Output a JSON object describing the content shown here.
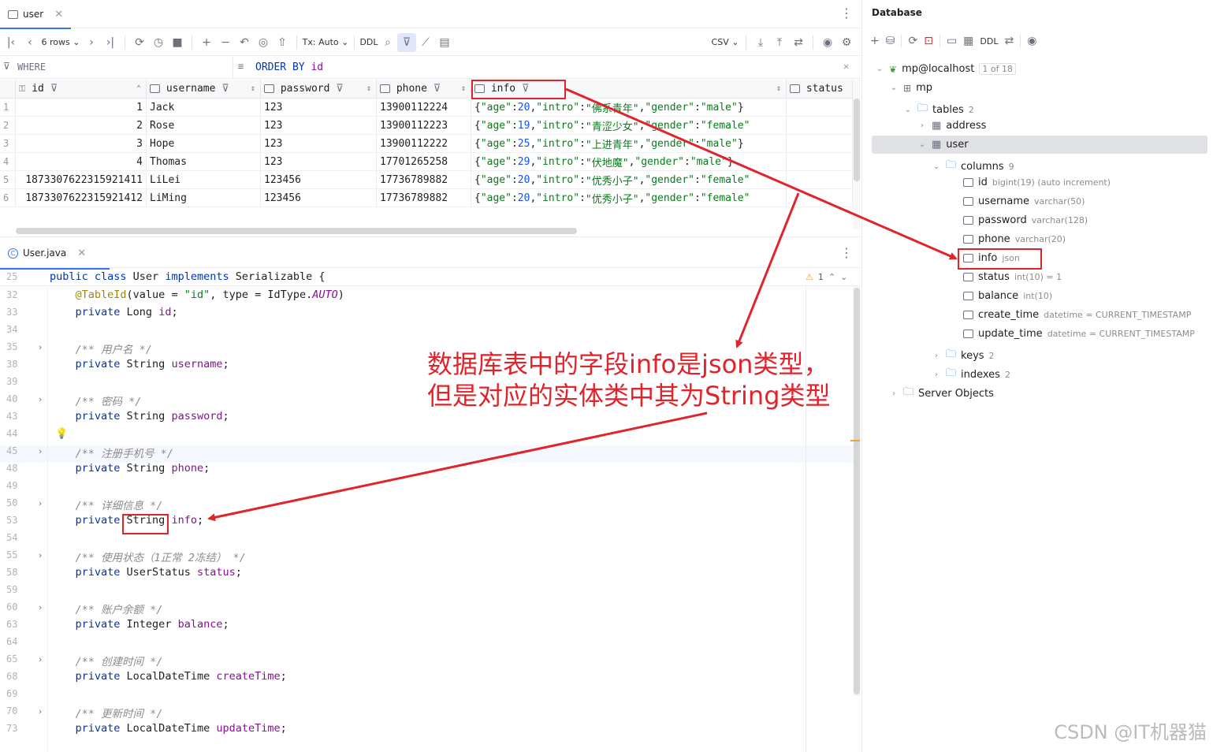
{
  "top_tab": {
    "label": "user"
  },
  "toolbar": {
    "rows_label": "6 rows",
    "tx_label": "Tx: Auto",
    "ddl_label": "DDL",
    "csv_label": "CSV"
  },
  "filter": {
    "where_label": "WHERE",
    "order_kw": "ORDER BY",
    "order_col": "id"
  },
  "grid": {
    "columns": [
      "id",
      "username",
      "password",
      "phone",
      "info",
      "status"
    ],
    "rows": [
      {
        "n": "1",
        "id": "1",
        "username": "Jack",
        "password": "123",
        "phone": "13900112224",
        "age": "20",
        "intro": "\"佛系青年\"",
        "gender": "\"male\"",
        "tail": "}"
      },
      {
        "n": "2",
        "id": "2",
        "username": "Rose",
        "password": "123",
        "phone": "13900112223",
        "age": "19",
        "intro": "\"青涩少女\"",
        "gender": "\"female\"",
        "tail": ""
      },
      {
        "n": "3",
        "id": "3",
        "username": "Hope",
        "password": "123",
        "phone": "13900112222",
        "age": "25",
        "intro": "\"上进青年\"",
        "gender": "\"male\"",
        "tail": "}"
      },
      {
        "n": "4",
        "id": "4",
        "username": "Thomas",
        "password": "123",
        "phone": "17701265258",
        "age": "29",
        "intro": "\"伏地魔\"",
        "gender": "\"male\"",
        "tail": "}"
      },
      {
        "n": "5",
        "id": "1873307622315921411",
        "username": "LiLei",
        "password": "123456",
        "phone": "17736789882",
        "age": "20",
        "intro": "\"优秀小子\"",
        "gender": "\"female\"",
        "tail": ""
      },
      {
        "n": "6",
        "id": "1873307622315921412",
        "username": "LiMing",
        "password": "123456",
        "phone": "17736789882",
        "age": "20",
        "intro": "\"优秀小子\"",
        "gender": "\"female\"",
        "tail": ""
      }
    ]
  },
  "editor": {
    "tab_label": "User.java",
    "warning": "1",
    "lines": [
      {
        "n": "25",
        "parts": [
          [
            "kw",
            "public class "
          ],
          [
            "pu",
            "User "
          ],
          [
            "kw",
            "implements "
          ],
          [
            "pu",
            "Serializable {"
          ]
        ]
      },
      {
        "n": "32",
        "parts": [
          [
            "an",
            "    @TableId"
          ],
          [
            "pu",
            "(value = "
          ],
          [
            "st",
            "\"id\""
          ],
          [
            "pu",
            ", type = IdType."
          ],
          [
            "fdi",
            "AUTO"
          ],
          [
            "pu",
            ")"
          ]
        ]
      },
      {
        "n": "33",
        "parts": [
          [
            "kw",
            "    private "
          ],
          [
            "pu",
            "Long "
          ],
          [
            "fd",
            "id"
          ],
          [
            "pu",
            ";"
          ]
        ]
      },
      {
        "n": "34",
        "parts": []
      },
      {
        "n": "35",
        "parts": [
          [
            "cm",
            "    /** 用户名 */"
          ]
        ]
      },
      {
        "n": "38",
        "parts": [
          [
            "kw",
            "    private "
          ],
          [
            "pu",
            "String "
          ],
          [
            "fd",
            "username"
          ],
          [
            "pu",
            ";"
          ]
        ]
      },
      {
        "n": "39",
        "parts": []
      },
      {
        "n": "40",
        "parts": [
          [
            "cm",
            "    /** 密码 */"
          ]
        ]
      },
      {
        "n": "43",
        "parts": [
          [
            "kw",
            "    private "
          ],
          [
            "pu",
            "String "
          ],
          [
            "fd",
            "password"
          ],
          [
            "pu",
            ";"
          ]
        ]
      },
      {
        "n": "44",
        "parts": []
      },
      {
        "n": "45",
        "parts": [
          [
            "cm",
            "    /** 注册手机号 */"
          ]
        ]
      },
      {
        "n": "48",
        "parts": [
          [
            "kw",
            "    private "
          ],
          [
            "pu",
            "String "
          ],
          [
            "fd",
            "phone"
          ],
          [
            "pu",
            ";"
          ]
        ]
      },
      {
        "n": "49",
        "parts": []
      },
      {
        "n": "50",
        "parts": [
          [
            "cm",
            "    /** 详细信息 */"
          ]
        ]
      },
      {
        "n": "53",
        "parts": [
          [
            "kw",
            "    private "
          ],
          [
            "pu",
            "String "
          ],
          [
            "fd",
            "info"
          ],
          [
            "pu",
            ";"
          ]
        ]
      },
      {
        "n": "54",
        "parts": []
      },
      {
        "n": "55",
        "parts": [
          [
            "cm",
            "    /** 使用状态（1正常 2冻结） */"
          ]
        ]
      },
      {
        "n": "58",
        "parts": [
          [
            "kw",
            "    private "
          ],
          [
            "pu",
            "UserStatus "
          ],
          [
            "fd",
            "status"
          ],
          [
            "pu",
            ";"
          ]
        ]
      },
      {
        "n": "59",
        "parts": []
      },
      {
        "n": "60",
        "parts": [
          [
            "cm",
            "    /** 账户余额 */"
          ]
        ]
      },
      {
        "n": "63",
        "parts": [
          [
            "kw",
            "    private "
          ],
          [
            "pu",
            "Integer "
          ],
          [
            "fd",
            "balance"
          ],
          [
            "pu",
            ";"
          ]
        ]
      },
      {
        "n": "64",
        "parts": []
      },
      {
        "n": "65",
        "parts": [
          [
            "cm",
            "    /** 创建时间 */"
          ]
        ]
      },
      {
        "n": "68",
        "parts": [
          [
            "kw",
            "    private "
          ],
          [
            "pu",
            "LocalDateTime "
          ],
          [
            "fd",
            "createTime"
          ],
          [
            "pu",
            ";"
          ]
        ]
      },
      {
        "n": "69",
        "parts": []
      },
      {
        "n": "70",
        "parts": [
          [
            "cm",
            "    /** 更新时间 */"
          ]
        ]
      },
      {
        "n": "73",
        "parts": [
          [
            "kw",
            "    private "
          ],
          [
            "pu",
            "LocalDateTime "
          ],
          [
            "fd",
            "updateTime"
          ],
          [
            "pu",
            ";"
          ]
        ]
      }
    ]
  },
  "db": {
    "title": "Database",
    "host": "mp@localhost",
    "host_badge": "1 of 18",
    "schema": "mp",
    "tables_label": "tables",
    "tables_count": "2",
    "table_address": "address",
    "table_user": "user",
    "columns_label": "columns",
    "columns_count": "9",
    "columns": [
      {
        "name": "id",
        "type": "bigint(19) (auto increment)"
      },
      {
        "name": "username",
        "type": "varchar(50)"
      },
      {
        "name": "password",
        "type": "varchar(128)"
      },
      {
        "name": "phone",
        "type": "varchar(20)"
      },
      {
        "name": "info",
        "type": "json"
      },
      {
        "name": "status",
        "type": "int(10) = 1"
      },
      {
        "name": "balance",
        "type": "int(10)"
      },
      {
        "name": "create_time",
        "type": "datetime = CURRENT_TIMESTAMP"
      },
      {
        "name": "update_time",
        "type": "datetime = CURRENT_TIMESTAMP"
      }
    ],
    "keys_label": "keys",
    "keys_count": "2",
    "indexes_label": "indexes",
    "indexes_count": "2",
    "server_objects": "Server Objects"
  },
  "annotation": {
    "line1": "数据库表中的字段info是json类型，",
    "line2": "但是对应的实体类中其为String类型"
  },
  "watermark": "CSDN @IT机器猫",
  "colors": {
    "accent": "#3574f0",
    "annotation": "#e0242b"
  }
}
